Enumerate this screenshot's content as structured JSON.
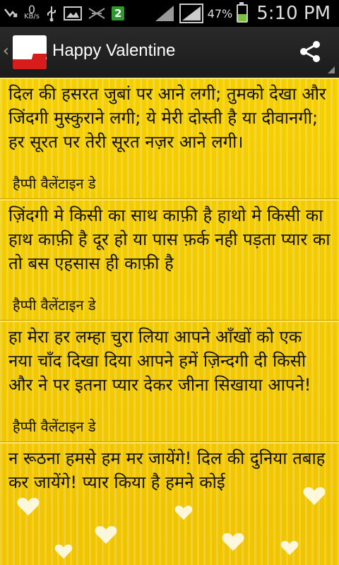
{
  "status_bar": {
    "network_speed": "0",
    "network_unit": "KB/s",
    "sim_badge": "2",
    "battery_percent": "47%",
    "time": "5:10 PM"
  },
  "action_bar": {
    "title": "Happy Valentine"
  },
  "quotes": [
    {
      "text": "दिल की हसरत जुबां पर आने लगी; तुमको देखा और जिंदगी मुस्कुराने लगी; ये मेरी दोस्ती है या दीवानगी; हर सूरत पर तेरी सूरत नज़र आने लगी।",
      "caption": "हैप्पी वैलेंटाइन डे"
    },
    {
      "text": "ज़िंदगी मे किसी का साथ काफ़ी है हाथो मे किसी का हाथ काफ़ी है दूर हो या पास फ़र्क नही पड़ता प्यार का तो बस एहसास ही काफ़ी है",
      "caption": "हैप्पी वैलेंटाइन डे"
    },
    {
      "text": "हा मेरा हर लम्हा चुरा लिया आपने आँखों को एक नया चाँद दिखा दिया आपने हमें ज़िन्दगी दी किसी और ने पर इतना प्यार देकर जीना सिखाया आपने!",
      "caption": "हैप्पी वैलेंटाइन डे"
    },
    {
      "text": "न रूठना हमसे हम मर जायेंगे! दिल की दुनिया तबाह कर जायेंगे! प्यार किया है हमने कोई",
      "caption": ""
    }
  ]
}
